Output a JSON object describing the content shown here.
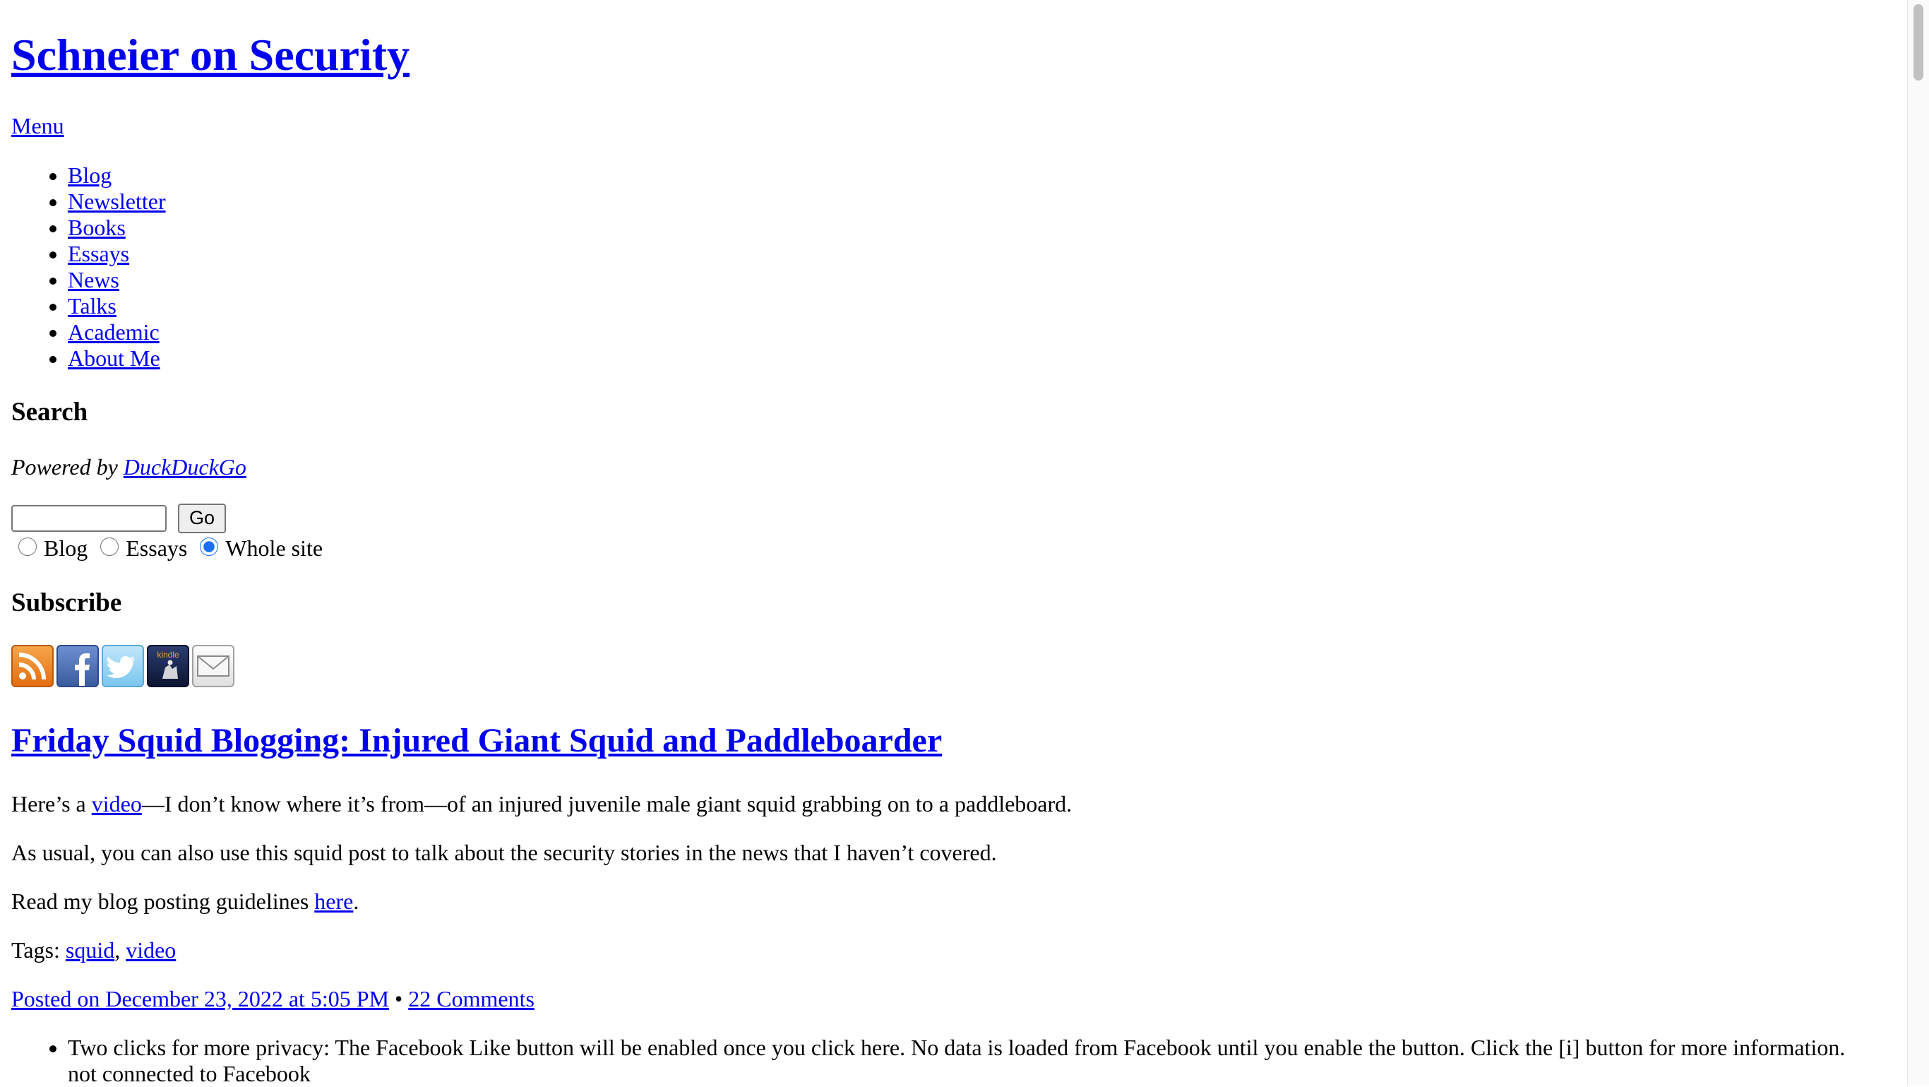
{
  "site": {
    "title": "Schneier on Security",
    "menu_label": "Menu"
  },
  "nav": {
    "items": [
      {
        "label": "Blog"
      },
      {
        "label": "Newsletter"
      },
      {
        "label": "Books"
      },
      {
        "label": "Essays"
      },
      {
        "label": "News"
      },
      {
        "label": "Talks"
      },
      {
        "label": "Academic"
      },
      {
        "label": "About Me"
      }
    ]
  },
  "search": {
    "heading": "Search",
    "powered_prefix": "Powered by ",
    "powered_link": "DuckDuckGo",
    "input_value": "",
    "go_label": "Go",
    "options": [
      {
        "label": "Blog",
        "checked": false
      },
      {
        "label": "Essays",
        "checked": false
      },
      {
        "label": "Whole site",
        "checked": true
      }
    ]
  },
  "subscribe": {
    "heading": "Subscribe",
    "icons": [
      "rss-icon",
      "facebook-icon",
      "twitter-icon",
      "kindle-icon",
      "email-icon"
    ],
    "kindle_text": "kindle"
  },
  "post": {
    "title": "Friday Squid Blogging: Injured Giant Squid and Paddleboarder",
    "p1_before": "Here’s a ",
    "p1_link": "video",
    "p1_after": "—I don’t know where it’s from—of an injured juvenile male giant squid grabbing on to a paddleboard.",
    "p2": "As usual, you can also use this squid post to talk about the security stories in the news that I haven’t covered.",
    "p3_before": "Read my blog posting guidelines ",
    "p3_link": "here",
    "p3_after": ".",
    "tags_label": "Tags: ",
    "tags": [
      "squid",
      "video"
    ],
    "tag_separator": ", ",
    "posted": "Posted on December 23, 2022 at 5:05 PM",
    "bullet_separator": " • ",
    "comments": "22 Comments"
  },
  "privacy": {
    "line1": "Two clicks for more privacy: The Facebook Like button will be enabled once you click here. No data is loaded from Facebook until you enable the button. Click the [i] button for more information.",
    "line2": "not connected to Facebook"
  },
  "colors": {
    "link": "#0000ee",
    "radio_accent": "#1a6ff4"
  }
}
